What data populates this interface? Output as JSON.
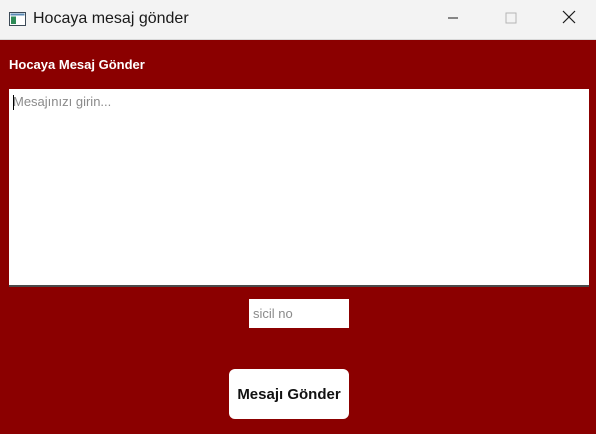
{
  "window": {
    "title": "Hocaya mesaj gönder",
    "icon": "app-window-icon",
    "controls": {
      "minimize": "minimize-icon",
      "maximize": "maximize-icon",
      "close": "close-icon"
    }
  },
  "colors": {
    "background": "#8b0000",
    "titlebar": "#f3f3f3",
    "input_background": "#ffffff",
    "button_background": "#ffffff"
  },
  "form": {
    "heading": "Hocaya Mesaj Gönder",
    "message": {
      "value": "",
      "placeholder": "Mesajınızı girin..."
    },
    "sicil": {
      "value": "",
      "placeholder": "sicil no"
    },
    "submit_label": "Mesajı Gönder"
  }
}
